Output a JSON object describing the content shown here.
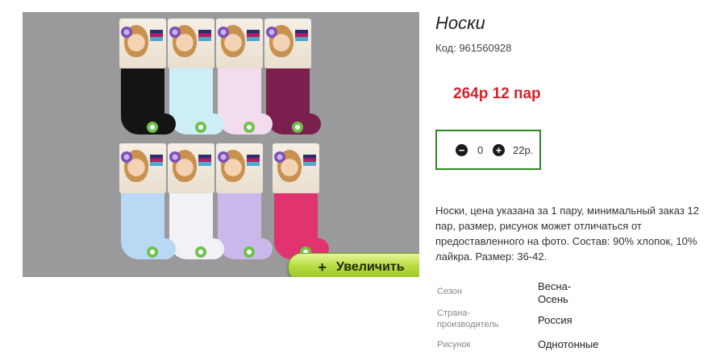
{
  "product": {
    "title": "Носки",
    "code": "Код: 961560928",
    "price": "264р  12 пар"
  },
  "quantity": {
    "minus_icon": "minus-circle-icon",
    "plus_icon": "plus-circle-icon",
    "value": "0",
    "total": "22р."
  },
  "gallery": {
    "zoom_label": "Увеличить",
    "zoom_icon": "+",
    "sock_colors": [
      "#141414",
      "#cdeef6",
      "#f3dcee",
      "#7b1f4e",
      "#b8d8f3",
      "#f1f1f6",
      "#cbb8ea",
      "#e0336f"
    ]
  },
  "description": "Носки, цена указана за 1 пару, минимальный заказ 12 пар, размер, рисунок может отличаться от предоставленного на фото. Состав: 90% хлопок, 10% лайкра. Размер: 36-42.",
  "specs": [
    {
      "label": "Сезон",
      "value": "Весна-\nОсень"
    },
    {
      "label": "Страна-\nпроизводитель",
      "value": "Россия"
    },
    {
      "label": "Рисунок",
      "value": "Однотонные"
    }
  ]
}
